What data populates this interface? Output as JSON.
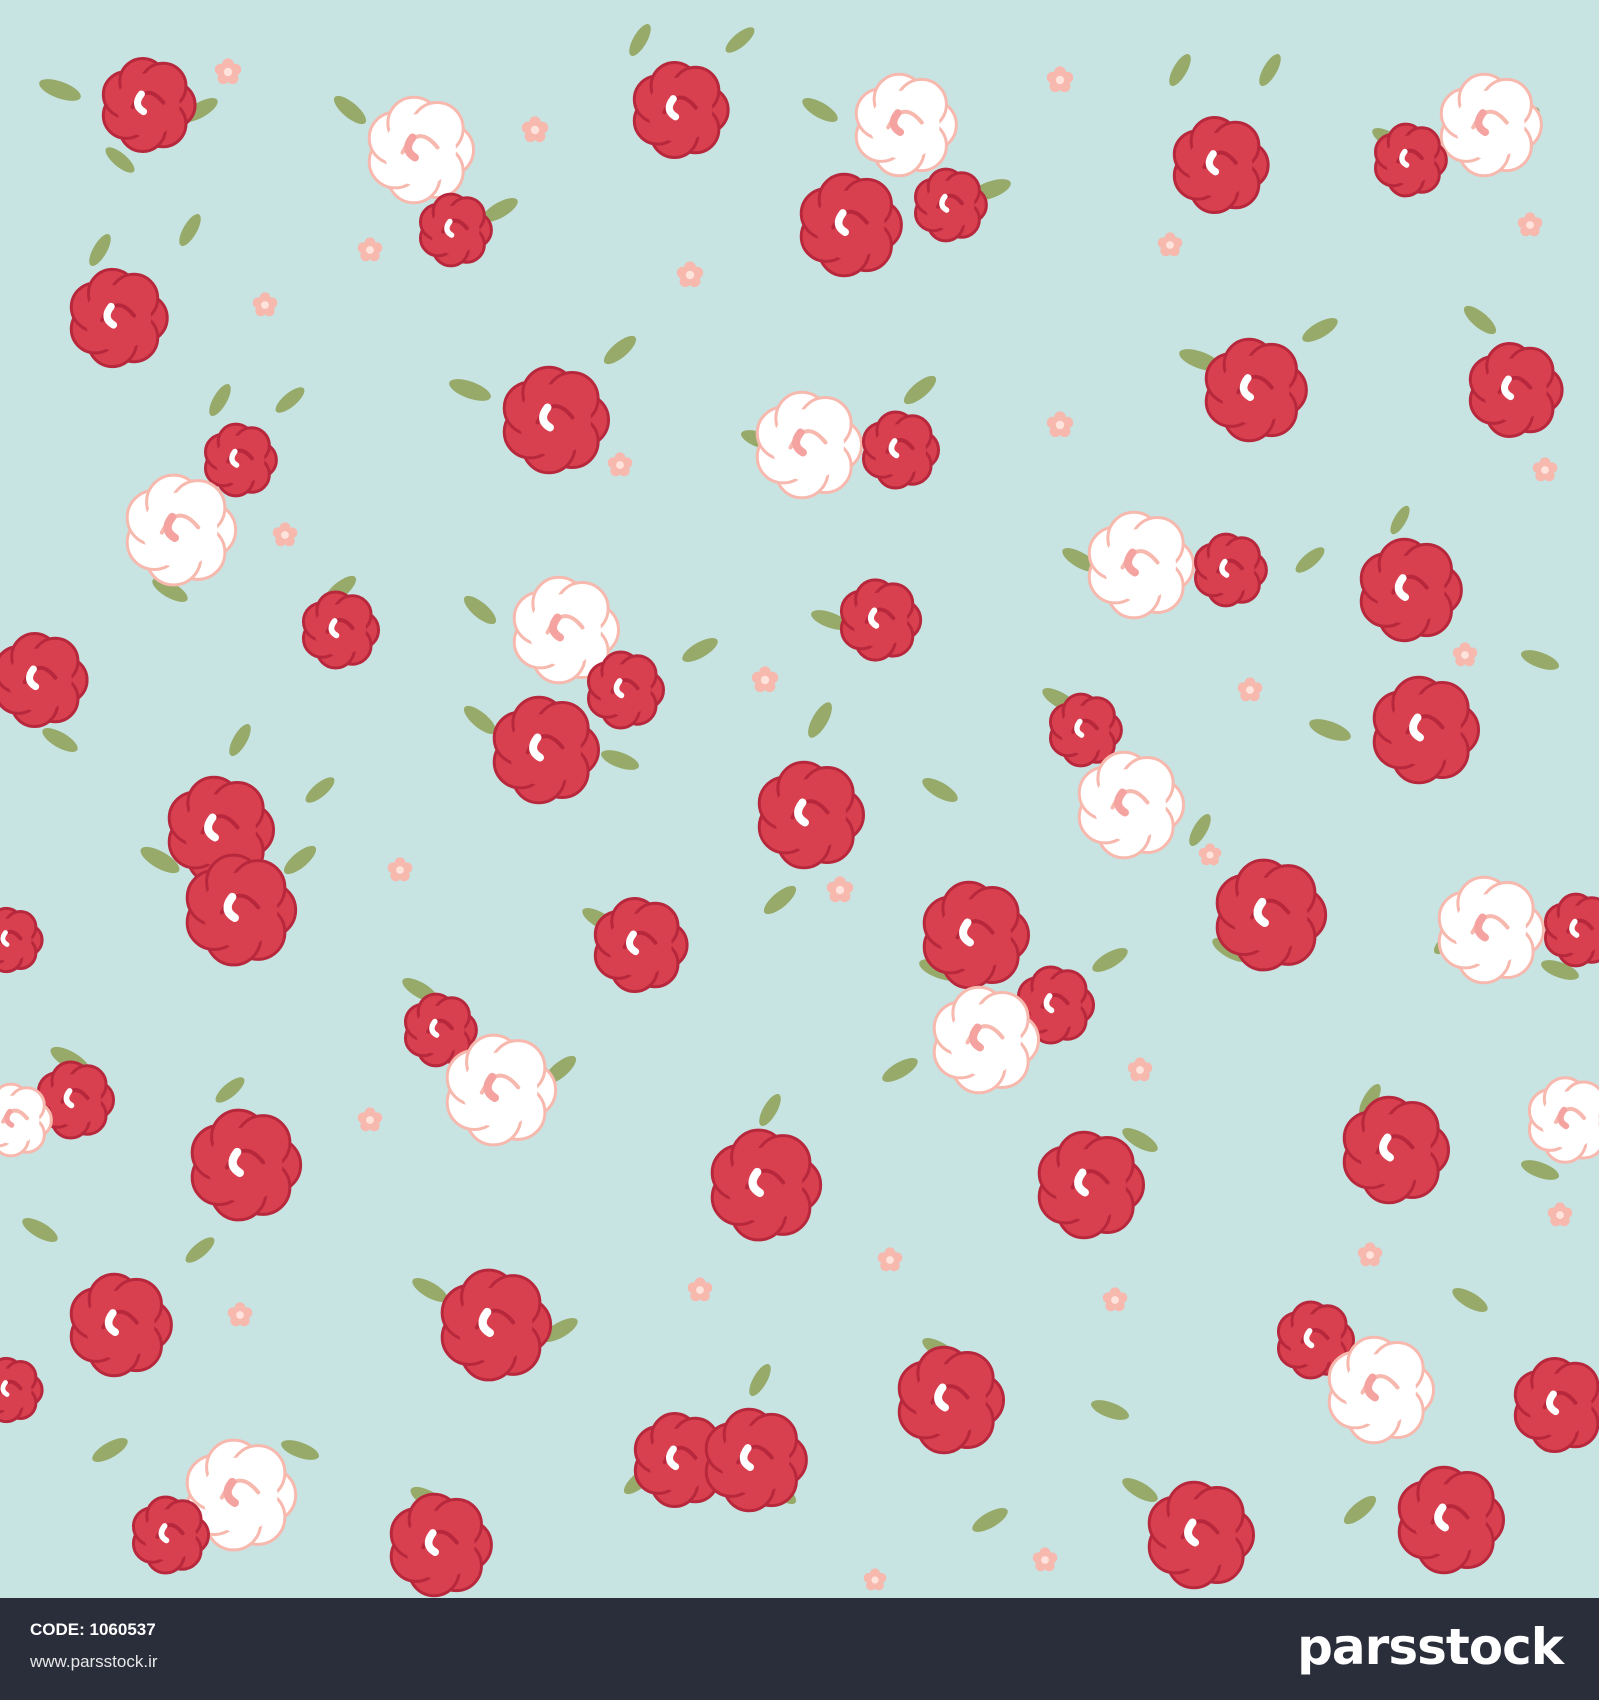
{
  "image": {
    "subject": "seamless floral pattern",
    "background_color": "#c7e4e3",
    "colors": {
      "red_rose": "#d9404f",
      "red_rose_dark": "#b8283c",
      "pink_flower": "#f7b8ae",
      "white_flower": "#ffffff",
      "leaf": "#97aa6a"
    }
  },
  "footer": {
    "code_label": "CODE: 1060537",
    "website": "www.parsstock.ir",
    "brand": "parsstock"
  }
}
